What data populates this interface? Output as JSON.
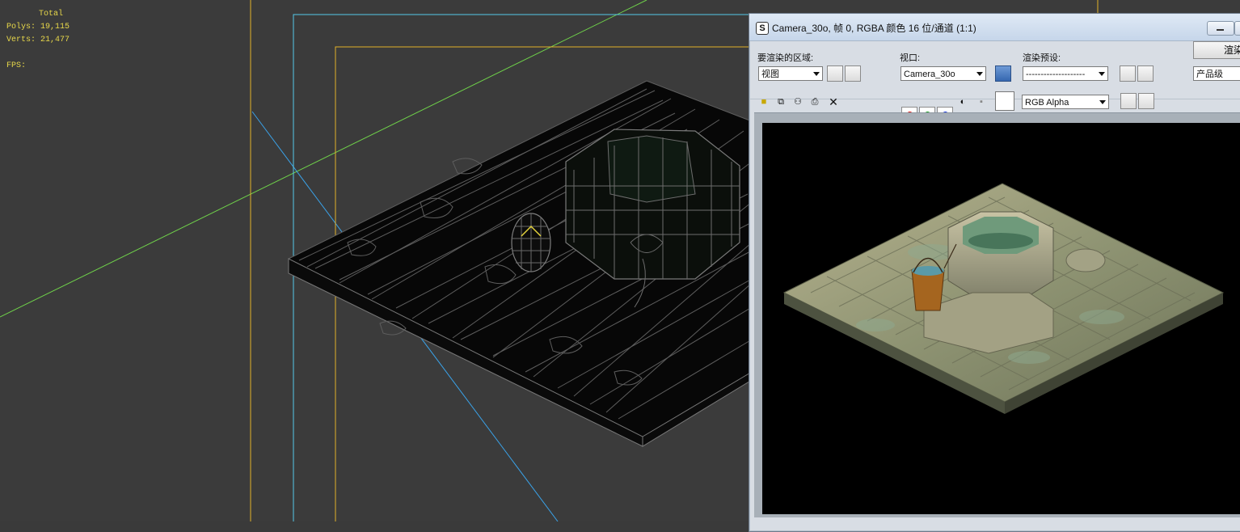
{
  "viewport": {
    "stats": {
      "total_label": "Total",
      "polys_label": "Polys:",
      "polys_value": "19,115",
      "verts_label": "Verts:",
      "verts_value": "21,477",
      "fps_label": "FPS:"
    },
    "colors": {
      "background": "#3b3b3b",
      "wire": "#8d8d8d",
      "safe_frame_yellow": "#e2b22a",
      "safe_frame_cyan": "#55c8e8",
      "grid_green": "#6fd14a",
      "grid_blue": "#3aa2e8",
      "stats_text": "#e8d84a"
    }
  },
  "render_window": {
    "title": "Camera_30o, 帧 0, RGBA 颜色 16 位/通道 (1:1)",
    "area_label": "要渲染的区域:",
    "area_value": "视图",
    "viewport_label": "视口:",
    "viewport_value": "Camera_30o",
    "preset_label": "渲染预设:",
    "preset_value": "--------------------",
    "render_button_label": "渲染",
    "quality_value": "产品级",
    "channel_value": "RGB Alpha"
  }
}
